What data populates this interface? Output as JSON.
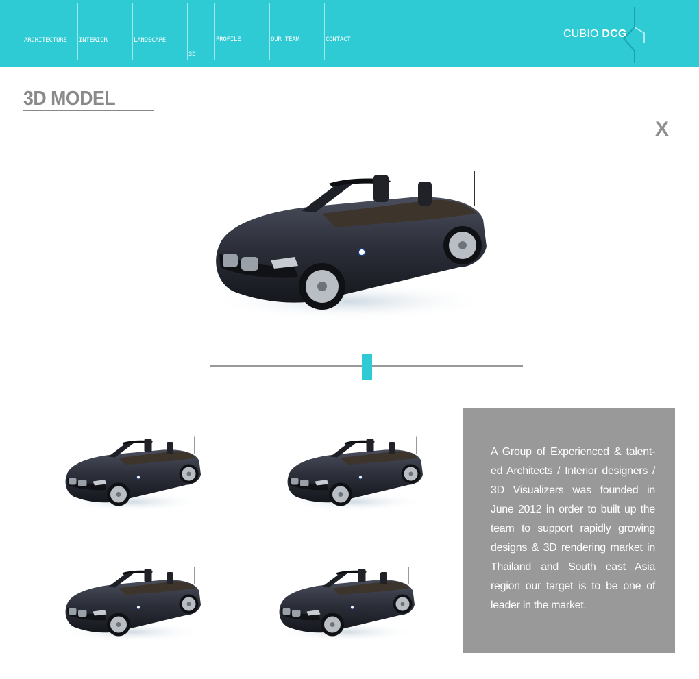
{
  "nav": {
    "items": [
      {
        "label": "ARCHITECTURE"
      },
      {
        "label": "INTERIOR"
      },
      {
        "label": "LANDSCAPE"
      },
      {
        "label": "3D"
      },
      {
        "label": "PROFILE"
      },
      {
        "label": "OUR TEAM"
      },
      {
        "label": "CONTACT"
      }
    ],
    "active": "3D",
    "background": "#2ecbd4"
  },
  "logo": {
    "text_light": "CUBIO",
    "text_bold": "DCG"
  },
  "page": {
    "title": "3D MODEL",
    "close_label": "X"
  },
  "gallery": {
    "main_image": "car-render",
    "thumbnails": [
      "car-render",
      "car-render",
      "car-render",
      "car-render"
    ],
    "slider_value": 0.5,
    "accent": "#2ecbd4"
  },
  "info": {
    "text": "A Group of Experienced & talent-ed Architects / Interior designers / 3D Visualizers was founded in June 2012 in order to built up the team to support rapidly growing designs & 3D rendering market in Thailand and South east Asia region our target is to be one of leader in the market."
  }
}
